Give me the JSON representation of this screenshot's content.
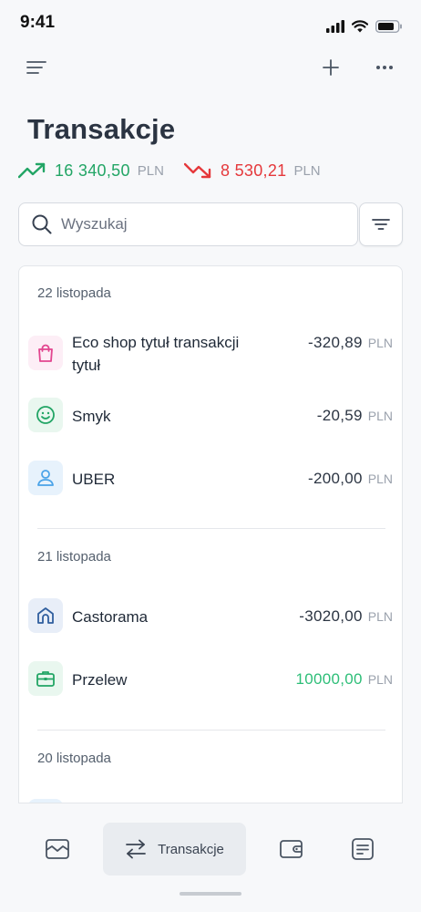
{
  "status": {
    "time": "9:41"
  },
  "page": {
    "title": "Transakcje"
  },
  "summary": {
    "income": "16 340,50",
    "expense": "8 530,21",
    "currency": "PLN"
  },
  "search": {
    "placeholder": "Wyszukaj",
    "value": ""
  },
  "groups": [
    {
      "date": "22 listopada",
      "items": [
        {
          "name": "Eco shop tytuł transakcji tytuł",
          "name_line1": "Eco shop tytuł transakcji",
          "name_line2": "tytuł",
          "amount": "-320,89",
          "currency": "PLN",
          "icon": "shopping-bag-icon"
        },
        {
          "name": "Smyk",
          "amount": "-20,59",
          "currency": "PLN",
          "icon": "smiley-icon"
        },
        {
          "name": "UBER",
          "amount": "-200,00",
          "currency": "PLN",
          "icon": "user-icon"
        }
      ]
    },
    {
      "date": "21 listopada",
      "items": [
        {
          "name": "Castorama",
          "amount": "-3020,00",
          "currency": "PLN",
          "icon": "home-icon"
        },
        {
          "name": "Przelew",
          "amount": "10000,00",
          "currency": "PLN",
          "icon": "briefcase-icon"
        }
      ]
    },
    {
      "date": "20 listopada",
      "items": []
    }
  ],
  "nav": {
    "items": [
      {
        "icon": "envelope-icon"
      },
      {
        "icon": "transfer-arrows-icon",
        "label": "Transakcje",
        "active": true
      },
      {
        "icon": "wallet-icon"
      },
      {
        "icon": "document-icon"
      }
    ]
  },
  "colors": {
    "income": "#22A565",
    "expense": "#E5383B",
    "positive_amount": "#2DBE78"
  }
}
